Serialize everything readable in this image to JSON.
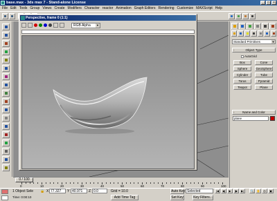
{
  "window": {
    "title": "base.max - 3ds max 7 - Stand-alone License",
    "buttons": [
      "_",
      "□",
      "×"
    ]
  },
  "menu": [
    "File",
    "Edit",
    "Tools",
    "Group",
    "Views",
    "Create",
    "Modifiers",
    "Character",
    "reactor",
    "Animation",
    "Graph Editors",
    "Rendering",
    "Customize",
    "MAXScript",
    "Help"
  ],
  "render_window": {
    "title": "Perspective, frame 0 (1:1)",
    "channel_dots": [
      "#d00000",
      "#008000",
      "#0000d0",
      "#404040"
    ],
    "channel_select": "RGB Alpha"
  },
  "time_slider": {
    "label": "0 / 100"
  },
  "track_ticks": [
    "0",
    "10",
    "20",
    "30",
    "40",
    "50",
    "60",
    "70",
    "80",
    "90",
    "100"
  ],
  "status": {
    "selection": "1 Object Sele",
    "x_label": "X",
    "x_value": "77.327",
    "y_label": "Y",
    "y_value": "40.971",
    "z_label": "Z",
    "z_value": "0.0",
    "grid": "Grid = 10.0",
    "time": "Time: 0:00:10",
    "add_time_tag": "Add Time Tag",
    "auto_key": "Auto Key",
    "set_key": "Set Key",
    "selected": "Selected",
    "key_filters": "Key Filters..."
  },
  "command_panel": {
    "dropdown": "Standard Primitives",
    "object_type_header": "Object Type",
    "autogrid": "AutoGrid",
    "objects": [
      "Box",
      "Cone",
      "Sphere",
      "GeoSphere",
      "Cylinder",
      "Tube",
      "Torus",
      "Pyramid",
      "Teapot",
      "Plane"
    ],
    "name_color_header": "Name and Color",
    "name_value": "plane",
    "color": "#c00000"
  },
  "colors": {
    "title_bar": "#0a246a",
    "ui_gray": "#d4d0c8",
    "viewport_gray": "#8e8e8e"
  }
}
